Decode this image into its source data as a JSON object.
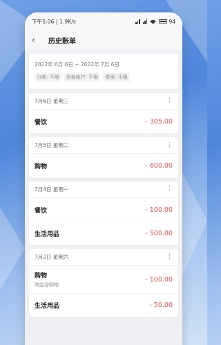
{
  "status": {
    "time_speed": "下午5:06 | 1.9K/s",
    "battery": "94"
  },
  "header": {
    "back_icon": "back-arrow-icon",
    "title": "历史账单"
  },
  "filter": {
    "date_range": "2022年 6月 6日 ~ 2022年 7月 6日",
    "tags": [
      "分类: 不限",
      "资金账户: 不限",
      "类型: 不限"
    ]
  },
  "days": [
    {
      "date": "7月6日 星期三",
      "entries": [
        {
          "category": "餐饮",
          "note": "",
          "amount": "- 305.00"
        }
      ]
    },
    {
      "date": "7月5日 星期二",
      "entries": [
        {
          "category": "购物",
          "note": "",
          "amount": "- 600.00"
        }
      ]
    },
    {
      "date": "7月4日 星期一",
      "entries": [
        {
          "category": "餐饮",
          "note": "",
          "amount": "- 100.00"
        },
        {
          "category": "生活用品",
          "note": "",
          "amount": "- 500.00"
        }
      ]
    },
    {
      "date": "7月2日 星期六",
      "entries": [
        {
          "category": "购物",
          "note": "淘宝@购物",
          "amount": "- 100.00"
        },
        {
          "category": "生活用品",
          "note": "",
          "amount": "- 50.00"
        }
      ]
    }
  ],
  "system_nav": {
    "menu_glyph": "≡",
    "home_glyph": "□",
    "back_glyph": "‹"
  },
  "colors": {
    "expense": "#e25555",
    "background_blue": "#4f86da"
  }
}
